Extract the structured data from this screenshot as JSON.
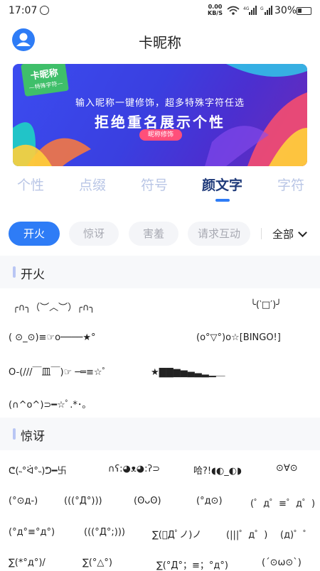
{
  "status_bar": {
    "time": "17:07",
    "net_speed_value": "0.00",
    "net_speed_unit": "KB/S",
    "battery": "30%"
  },
  "header": {
    "title": "卡昵称"
  },
  "banner": {
    "tag_title": "卡昵称",
    "tag_sub": "—特殊字符—",
    "line1": "输入昵称一键修饰，超多特殊字符任选",
    "line2": "拒绝重名展示个性",
    "button": "昵称修饰"
  },
  "tabs": [
    {
      "label": "个性",
      "active": false
    },
    {
      "label": "点缀",
      "active": false
    },
    {
      "label": "符号",
      "active": false
    },
    {
      "label": "颜文字",
      "active": true
    },
    {
      "label": "字符",
      "active": false
    }
  ],
  "chips": {
    "items": [
      {
        "label": "开火",
        "active": true
      },
      {
        "label": "惊讶",
        "active": false
      },
      {
        "label": "害羞",
        "active": false
      },
      {
        "label": "请求互动",
        "active": false
      }
    ],
    "all_label": "全部"
  },
  "sections": [
    {
      "title": "开火",
      "items": [
        "╭∩╮（︶︿︶）╭∩╮",
        "╰(‵□′)╯",
        "( ⊙_⊙)≡☞o────★°",
        "(o°▽°)o☆[BINGO!]",
        "O-(///￣皿￣)☞ ─═≡☆゜",
        "★▇▇▆▅▄▃▂▁＿",
        "(∩^o^)⊃━☆ﾟ.*･｡"
      ]
    },
    {
      "title": "惊讶",
      "items": [
        "ᕦ(˵°ᐛ°˵)ᕤ━卐",
        "∩ʕ:◕ᴥ◕:ʔ⊃",
        "哈?!◖◐_◐◗",
        "⊙∀⊙",
        "(°⊙д-)",
        "(((°Д°)))",
        "(ʘᴗʘ)",
        "(°д⊙)",
        "(゜д゜≡゜д゜)",
        "(°д°≡°д°)",
        "(((°Д°;)))",
        "∑(ﾟДﾟノ)ノ",
        "(|||゜д゜)",
        "(д)゜゜",
        "∑(*°д°)/",
        "∑(°△°)",
        "∑(°Д°；≡；°д°)",
        "(´⊙ω⊙`)"
      ]
    }
  ]
}
